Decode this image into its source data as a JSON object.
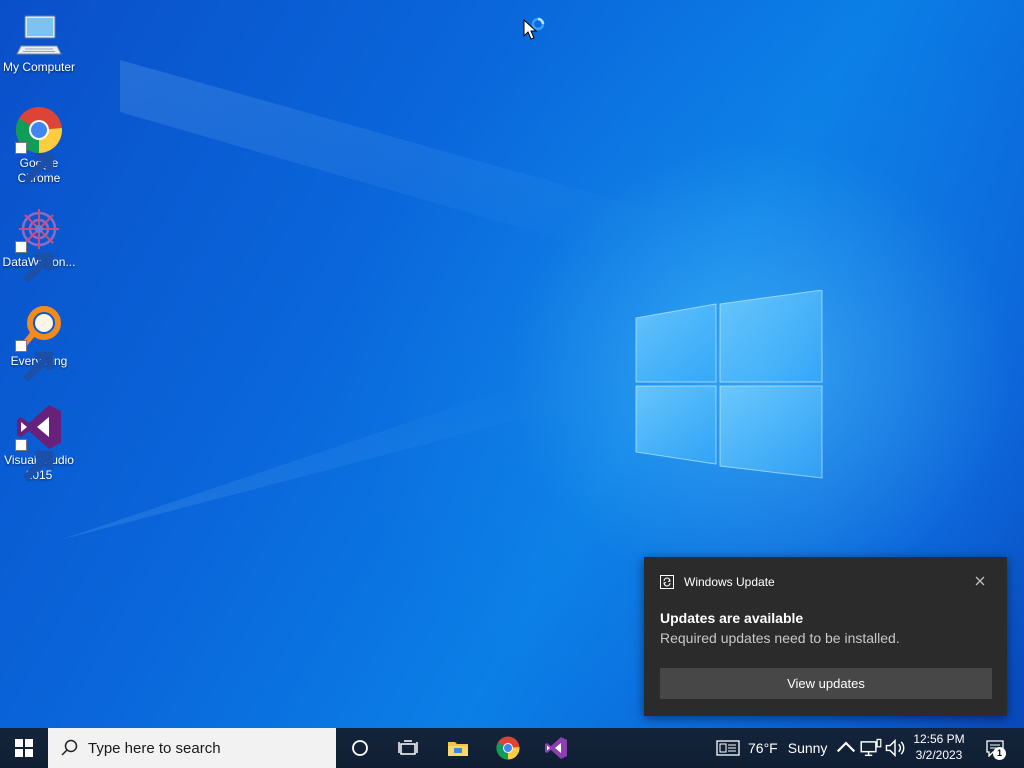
{
  "desktop": {
    "icons": [
      {
        "label": "My Computer",
        "icon": "computer-icon"
      },
      {
        "label": "Google Chrome",
        "icon": "chrome-icon"
      },
      {
        "label": "DataWagon...",
        "icon": "datawagon-icon"
      },
      {
        "label": "Everything",
        "icon": "everything-icon"
      },
      {
        "label": "Visual Studio 2015",
        "icon": "visual-studio-icon"
      }
    ]
  },
  "notification": {
    "app": "Windows Update",
    "title": "Updates are available",
    "body": "Required updates need to be installed.",
    "button": "View updates"
  },
  "taskbar": {
    "search_placeholder": "Type here to search",
    "pinned": [
      "cortana-icon",
      "task-view-icon",
      "file-explorer-icon",
      "chrome-icon",
      "visual-studio-icon"
    ],
    "weather": {
      "temp": "76°F",
      "condition": "Sunny"
    },
    "clock": {
      "time": "12:56 PM",
      "date": "3/2/2023"
    },
    "notification_count": "1"
  },
  "colors": {
    "accent": "#0a67db",
    "taskbar": "#14243a",
    "toast": "#2b2b2b"
  }
}
